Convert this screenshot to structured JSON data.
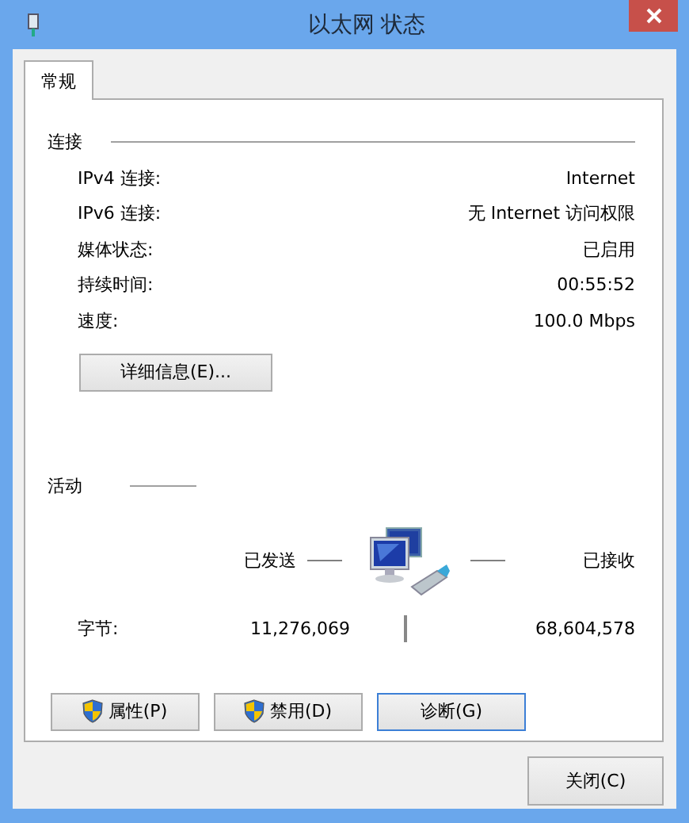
{
  "window": {
    "title": "以太网 状态"
  },
  "tabs": [
    {
      "label": "常规",
      "selected": true
    }
  ],
  "connection": {
    "heading": "连接",
    "rows": [
      {
        "label": "IPv4 连接:",
        "value": "Internet"
      },
      {
        "label": "IPv6 连接:",
        "value": "无 Internet 访问权限"
      },
      {
        "label": "媒体状态:",
        "value": "已启用"
      },
      {
        "label": "持续时间:",
        "value": "00:55:52"
      },
      {
        "label": "速度:",
        "value": "100.0 Mbps"
      }
    ],
    "details_button": "详细信息(E)..."
  },
  "activity": {
    "heading": "活动",
    "sent_label": "已发送",
    "received_label": "已接收",
    "bytes_label": "字节:",
    "bytes_sent": "11,276,069",
    "bytes_received": "68,604,578"
  },
  "buttons": [
    {
      "label": "属性(P)",
      "shield": true,
      "focused": false
    },
    {
      "label": "禁用(D)",
      "shield": true,
      "focused": false
    },
    {
      "label": "诊断(G)",
      "shield": false,
      "focused": true
    }
  ],
  "close_button": "关闭(C)"
}
